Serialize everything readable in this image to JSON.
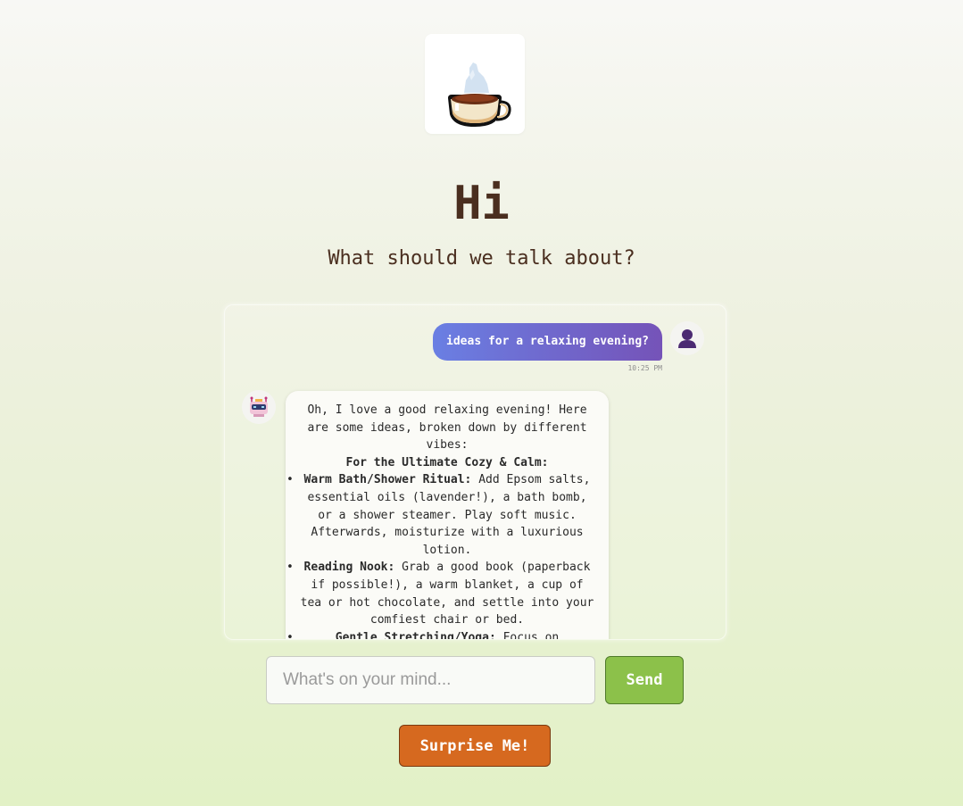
{
  "header": {
    "logo_icon": "coffee-cup-icon",
    "greeting": "Hi",
    "subtitle": "What should we talk about?"
  },
  "chat": {
    "user_message": {
      "text": "ideas for a relaxing evening?",
      "time": "10:25 PM",
      "avatar_icon": "user-silhouette-icon"
    },
    "bot_message": {
      "avatar_icon": "robot-icon",
      "intro": "Oh, I love a good relaxing evening! Here are some ideas, broken down by different vibes:",
      "section_title": "For the Ultimate Cozy & Calm:",
      "items": [
        {
          "title": "Warm Bath/Shower Ritual:",
          "text": " Add Epsom salts, essential oils (lavender!), a bath bomb, or a shower steamer. Play soft music. Afterwards, moisturize with a luxurious lotion."
        },
        {
          "title": "Reading Nook:",
          "text": " Grab a good book (paperback if possible!), a warm blanket, a cup of tea or hot chocolate, and settle into your comfiest chair or bed."
        },
        {
          "title": "Gentle Stretching/Yoga:",
          "text": " Focus on"
        }
      ]
    }
  },
  "composer": {
    "placeholder": "What's on your mind...",
    "send_label": "Send",
    "surprise_label": "Surprise Me!"
  },
  "colors": {
    "accent_green": "#8cc14a",
    "accent_orange": "#d6691f",
    "user_bubble_start": "#6a7fe3",
    "user_bubble_end": "#7553b8",
    "text_brown": "#4a2e1f"
  }
}
